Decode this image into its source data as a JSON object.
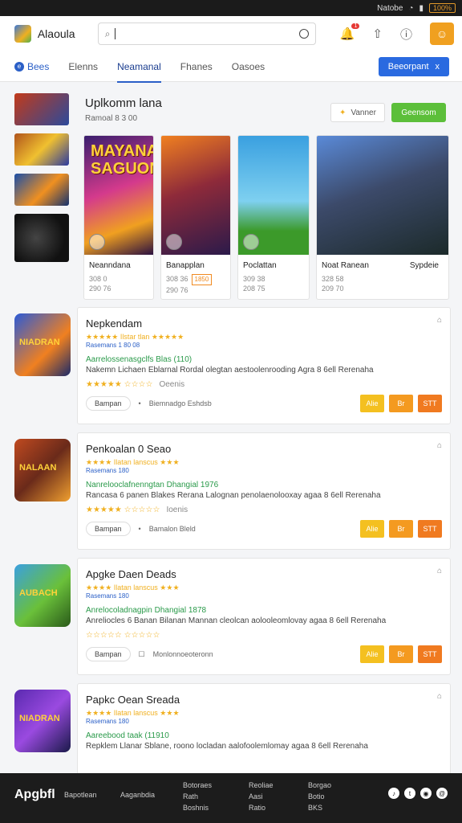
{
  "statusbar": {
    "carrier": "Natobe",
    "battery": "100%"
  },
  "appbar": {
    "brand": "Alaoula",
    "search_placeholder": "",
    "notif_count": "1"
  },
  "tabs": [
    {
      "label": "Bees"
    },
    {
      "label": "Elenns"
    },
    {
      "label": "Neamanal"
    },
    {
      "label": "Fhanes"
    },
    {
      "label": "Oasoes"
    }
  ],
  "tabs_cta": {
    "label": "Beeorpant",
    "icon": "x"
  },
  "hero": {
    "title": "Uplkomm lana",
    "subtitle": "Ramoal 8 3 00",
    "outline_btn": "Vanner",
    "green_btn": "Geensom"
  },
  "cards": [
    {
      "art_text": "MAYANA SAGUON",
      "name": "Neanndana",
      "meta1": "308 0",
      "meta2": "290 76"
    },
    {
      "art_text": "",
      "name": "Banapplan",
      "meta1": "308 36",
      "meta2": "290 76",
      "tag": "1850"
    },
    {
      "art_text": "",
      "name": "Poclattan",
      "meta1": "309 38",
      "meta2": "208 75"
    },
    {
      "art_text": "",
      "name": "Noat Ranean",
      "name2": "Sypdeie",
      "meta1": "328 58",
      "meta2": "209 70"
    }
  ],
  "list": [
    {
      "icon_text": "NIADRAN",
      "title": "Nepkendam",
      "stars": "★★★★★ Ilstar tlan ★★★★★",
      "sub": "Rasemans 1 80 08",
      "green": "Aarrelossenasgclfs Blas (110)",
      "desc": "Nakemn Lichaen Eblarnal Rordal olegtan aestoolenrooding Agra 8 6ell Rerenaha",
      "rating": "★★★★★ ☆☆☆☆",
      "rating_note": "Oeenis",
      "pill": "Bampan",
      "bottom_note": "Biemnadgo Eshdsb",
      "btn1": "Alie",
      "btn2": "Br",
      "btn3": "STT"
    },
    {
      "icon_text": "NALAAN",
      "title": "Penkoalan 0 Seao",
      "stars": "★★★★ Ilatan lanscus ★★★",
      "sub": "Rasemans 180",
      "green": "Nanrelooclafnenngtan Dhangial 1976",
      "desc": "Rancasa 6 panen Blakes Rerana Lalognan penolaenolooxay agaa 8 6ell Rerenaha",
      "rating": "★★★★★ ☆☆☆☆☆",
      "rating_note": "Ioenis",
      "pill": "Bampan",
      "bottom_note": "Bamalon Bleld",
      "btn1": "Alie",
      "btn2": "Br",
      "btn3": "STT"
    },
    {
      "icon_text": "AUBACH",
      "title": "Apgke Daen Deads",
      "stars": "★★★★ Ilatan lanscus ★★★",
      "sub": "Rasemans 180",
      "green": "Anrelocoladnagpin Dhangial 1878",
      "desc": "Anreliocles 6 Banan Bilanan Mannan cleolcan aolooleomlovay agaa 8 6ell Rerenaha",
      "rating": "☆☆☆☆☆ ☆☆☆☆☆",
      "rating_note": "",
      "pill": "Bampan",
      "bottom_note": "Monlonnoeoteronn",
      "btn1": "Alie",
      "btn2": "Br",
      "btn3": "STT"
    },
    {
      "icon_text": "NIADRAN",
      "title": "Papkc Oean Sreada",
      "stars": "★★★★ Ilatan lanscus ★★★",
      "sub": "Rasemans 180",
      "green": "Aareebood taak (11910",
      "desc": "Repklem Llanar Sblane, roono locladan aalofoolemlomay agaa 8 6ell Rerenaha",
      "rating": "",
      "rating_note": "",
      "pill": "",
      "bottom_note": "",
      "btn1": "",
      "btn2": "",
      "btn3": ""
    }
  ],
  "footer": {
    "logo": "Apgbfl",
    "col1": [
      "Bapotlean"
    ],
    "col2": [
      "Aaganbdia"
    ],
    "col3": [
      "Botoraes",
      "Rath",
      "Boshnis"
    ],
    "col4": [
      "Reoliae",
      "Aasi",
      "Ratio"
    ],
    "col5": [
      "Borgao",
      "Botio",
      "BKS"
    ]
  }
}
